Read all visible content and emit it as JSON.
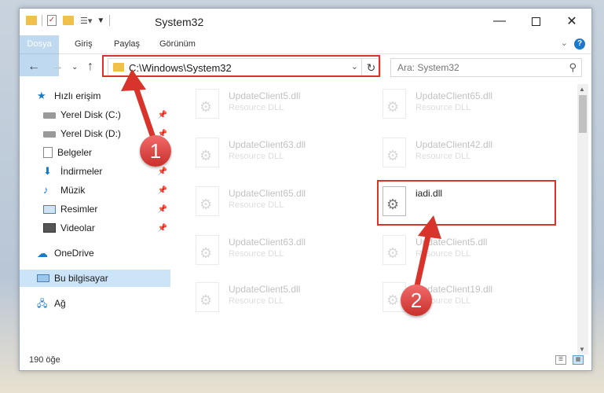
{
  "window": {
    "title": "System32",
    "minimize_icon": "minimize-icon",
    "maximize_icon": "maximize-icon",
    "close_icon": "close-icon"
  },
  "ribbon": {
    "tabs": [
      {
        "label": "Dosya"
      },
      {
        "label": "Giriş"
      },
      {
        "label": "Paylaş"
      },
      {
        "label": "Görünüm"
      }
    ]
  },
  "address": {
    "path": "C:\\Windows\\System32"
  },
  "search": {
    "placeholder": "Ara: System32"
  },
  "nav": {
    "items": [
      {
        "label": "Hızlı erişim"
      },
      {
        "label": "Yerel Disk (C:)"
      },
      {
        "label": "Yerel Disk (D:)"
      },
      {
        "label": "Belgeler"
      },
      {
        "label": "İndirmeler"
      },
      {
        "label": "Müzik"
      },
      {
        "label": "Resimler"
      },
      {
        "label": "Videolar"
      },
      {
        "label": "OneDrive"
      },
      {
        "label": "Bu bilgisayar"
      },
      {
        "label": "Ağ"
      }
    ]
  },
  "files": [
    {
      "name": "UpdateClient5.dll",
      "type": "Resource DLL"
    },
    {
      "name": "UpdateClient65.dll",
      "type": "Resource DLL"
    },
    {
      "name": "UpdateClient63.dll",
      "type": "Resource DLL"
    },
    {
      "name": "UpdateClient42.dll",
      "type": "Resource DLL"
    },
    {
      "name": "UpdateClient65.dll",
      "type": "Resource DLL"
    },
    {
      "name": "iadi.dll",
      "type": ""
    },
    {
      "name": "UpdateClient63.dll",
      "type": "Resource DLL"
    },
    {
      "name": "UpdateClient5.dll",
      "type": "Resource DLL"
    },
    {
      "name": "UpdateClient5.dll",
      "type": "Resource DLL"
    },
    {
      "name": "UpdateClient19.dll",
      "type": "Resource DLL"
    }
  ],
  "status": {
    "count": "190 öğe"
  },
  "annotations": {
    "step1": "1",
    "step2": "2",
    "color": "#d9342b"
  }
}
